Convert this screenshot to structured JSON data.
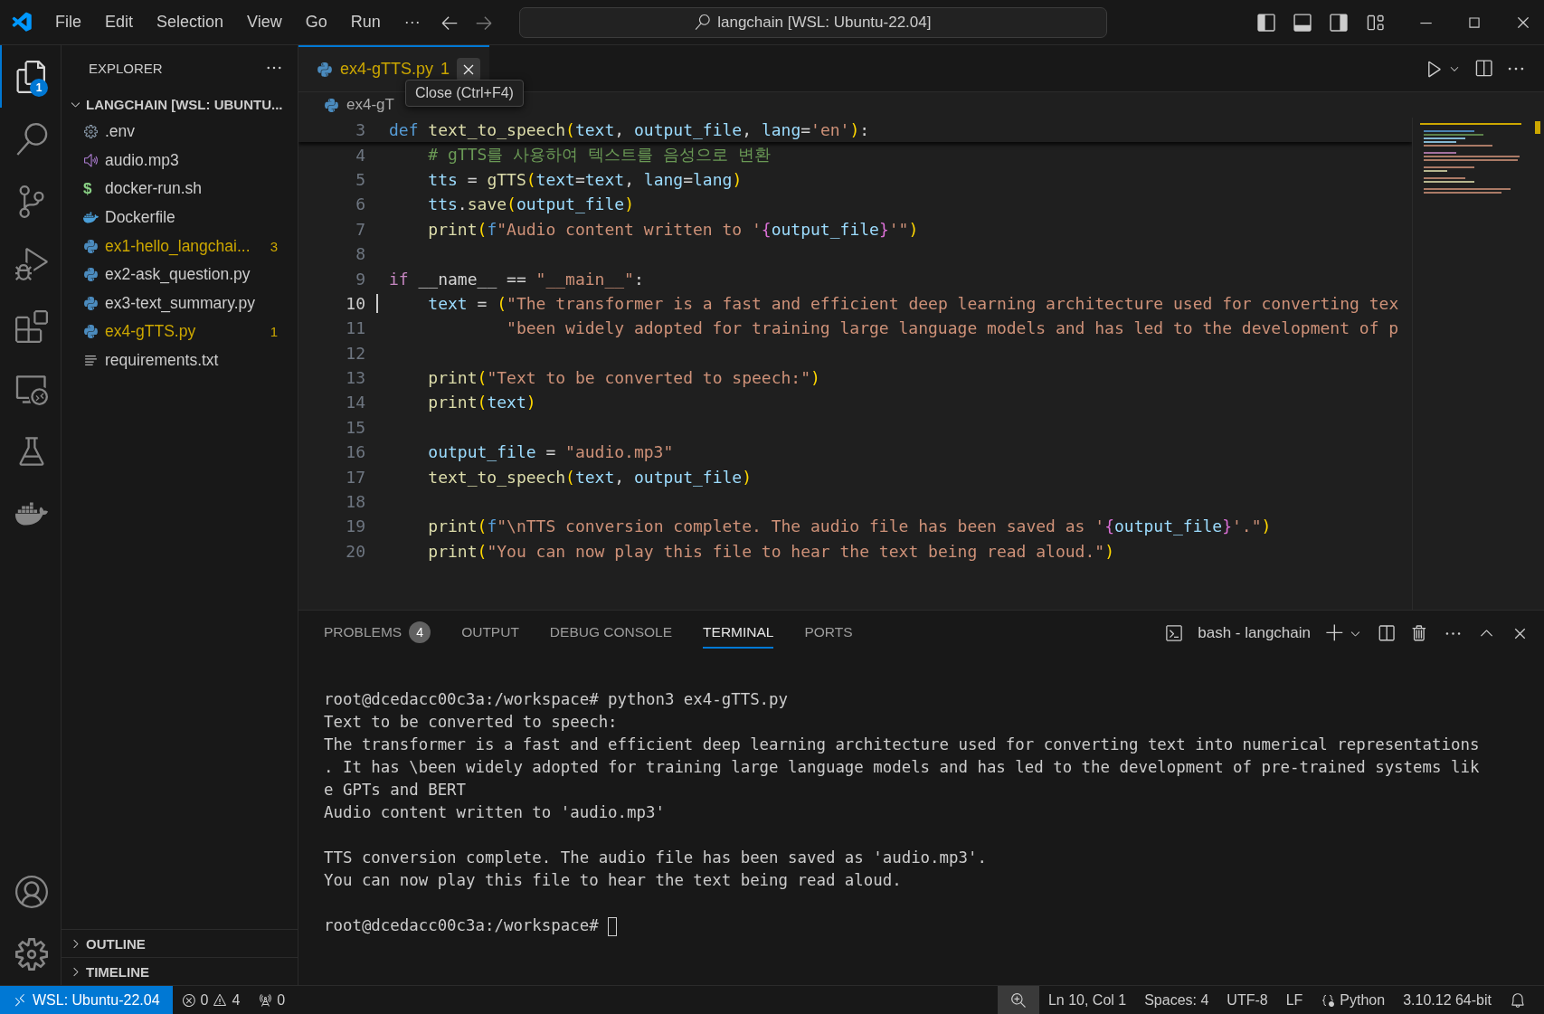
{
  "title_bar": {
    "menu": [
      "File",
      "Edit",
      "Selection",
      "View",
      "Go",
      "Run",
      "···"
    ],
    "search": "langchain [WSL: Ubuntu-22.04]"
  },
  "activity_bar": {
    "top": [
      {
        "kind": "files",
        "selected": true,
        "badge": "1"
      },
      {
        "kind": "search",
        "selected": false
      },
      {
        "kind": "source-control",
        "selected": false
      },
      {
        "kind": "run-debug",
        "selected": false
      },
      {
        "kind": "extensions",
        "selected": false
      },
      {
        "kind": "remote",
        "selected": false
      },
      {
        "kind": "testing",
        "selected": false
      },
      {
        "kind": "docker",
        "selected": false
      }
    ],
    "bottom": [
      {
        "kind": "account",
        "selected": false
      },
      {
        "kind": "settings",
        "selected": false
      }
    ]
  },
  "sidebar": {
    "title": "EXPLORER",
    "folder": {
      "label": "LANGCHAIN [WSL: UBUNTU...",
      "expanded": true
    },
    "files": [
      {
        "name": ".env",
        "kind": "config",
        "warning": false
      },
      {
        "name": "audio.mp3",
        "kind": "audio",
        "warning": false
      },
      {
        "name": "docker-run.sh",
        "kind": "shell",
        "glyph": "$",
        "warning": false
      },
      {
        "name": "Dockerfile",
        "kind": "docker",
        "warning": false
      },
      {
        "name": "ex1-hello_langchai...",
        "kind": "python",
        "warning": true,
        "badge": "3"
      },
      {
        "name": "ex2-ask_question.py",
        "kind": "python",
        "warning": false
      },
      {
        "name": "ex3-text_summary.py",
        "kind": "python",
        "warning": false
      },
      {
        "name": "ex4-gTTS.py",
        "kind": "python",
        "warning": true,
        "badge": "1"
      },
      {
        "name": "requirements.txt",
        "kind": "text",
        "warning": false
      }
    ],
    "sections": [
      {
        "label": "OUTLINE",
        "expanded": false
      },
      {
        "label": "TIMELINE",
        "expanded": false
      }
    ]
  },
  "editor": {
    "tabs": [
      {
        "label": "ex4-gTTS.py",
        "badge": "1",
        "selected": true,
        "warning": true
      }
    ],
    "tooltip": "Close (Ctrl+F4)",
    "breadcrumb": "ex4-gT",
    "sticky_line": {
      "num": "3",
      "tokens": [
        {
          "t": "def",
          "kind": "kw"
        },
        {
          "t": " text_to_speech",
          "kind": "fn"
        },
        {
          "t": "(",
          "kind": "br"
        },
        {
          "t": "text",
          "kind": "var"
        },
        {
          "t": ", ",
          "kind": "p"
        },
        {
          "t": "output_file",
          "kind": "var"
        },
        {
          "t": ", ",
          "kind": "p"
        },
        {
          "t": "lang",
          "kind": "var"
        },
        {
          "t": "=",
          "kind": "p"
        },
        {
          "t": "'en'",
          "kind": "str"
        },
        {
          "t": ")",
          "kind": "br"
        },
        {
          "t": ":",
          "kind": "p"
        }
      ]
    },
    "lines": [
      {
        "num": "4",
        "current": false,
        "tokens": [
          {
            "t": "    # gTTS를 사용하여 텍스트를 음성으로 변환",
            "kind": "com"
          }
        ]
      },
      {
        "num": "5",
        "current": false,
        "tokens": [
          {
            "t": "    tts",
            "kind": "var"
          },
          {
            "t": " = ",
            "kind": "p"
          },
          {
            "t": "gTTS",
            "kind": "fn"
          },
          {
            "t": "(",
            "kind": "br"
          },
          {
            "t": "text",
            "kind": "var"
          },
          {
            "t": "=",
            "kind": "p"
          },
          {
            "t": "text",
            "kind": "var"
          },
          {
            "t": ", ",
            "kind": "p"
          },
          {
            "t": "lang",
            "kind": "var"
          },
          {
            "t": "=",
            "kind": "p"
          },
          {
            "t": "lang",
            "kind": "var"
          },
          {
            "t": ")",
            "kind": "br"
          }
        ]
      },
      {
        "num": "6",
        "current": false,
        "tokens": [
          {
            "t": "    tts",
            "kind": "var"
          },
          {
            "t": ".",
            "kind": "p"
          },
          {
            "t": "save",
            "kind": "fn"
          },
          {
            "t": "(",
            "kind": "br"
          },
          {
            "t": "output_file",
            "kind": "var"
          },
          {
            "t": ")",
            "kind": "br"
          }
        ]
      },
      {
        "num": "7",
        "current": false,
        "tokens": [
          {
            "t": "    print",
            "kind": "fn"
          },
          {
            "t": "(",
            "kind": "br"
          },
          {
            "t": "f",
            "kind": "kw"
          },
          {
            "t": "\"Audio content written to '",
            "kind": "str"
          },
          {
            "t": "{",
            "kind": "brace"
          },
          {
            "t": "output_file",
            "kind": "var"
          },
          {
            "t": "}",
            "kind": "brace"
          },
          {
            "t": "'\"",
            "kind": "str"
          },
          {
            "t": ")",
            "kind": "br"
          }
        ]
      },
      {
        "num": "8",
        "current": false
      },
      {
        "num": "9",
        "current": false,
        "tokens": [
          {
            "t": "if",
            "kind": "ctl"
          },
          {
            "t": " __name__ == ",
            "kind": "p"
          },
          {
            "t": "\"__main__\"",
            "kind": "str"
          },
          {
            "t": ":",
            "kind": "p"
          }
        ]
      },
      {
        "num": "10",
        "current": true,
        "tokens": [
          {
            "t": "    text",
            "kind": "var"
          },
          {
            "t": " = ",
            "kind": "p"
          },
          {
            "t": "(",
            "kind": "br"
          },
          {
            "t": "\"The transformer is a fast and efficient deep learning architecture used for converting tex",
            "kind": "str"
          }
        ]
      },
      {
        "num": "11",
        "current": false,
        "tokens": [
          {
            "t": "            \"been widely adopted for training large language models and has led to the development of p",
            "kind": "str"
          }
        ]
      },
      {
        "num": "12",
        "current": false
      },
      {
        "num": "13",
        "current": false,
        "tokens": [
          {
            "t": "    print",
            "kind": "fn"
          },
          {
            "t": "(",
            "kind": "br"
          },
          {
            "t": "\"Text to be converted to speech:\"",
            "kind": "str"
          },
          {
            "t": ")",
            "kind": "br"
          }
        ]
      },
      {
        "num": "14",
        "current": false,
        "tokens": [
          {
            "t": "    print",
            "kind": "fn"
          },
          {
            "t": "(",
            "kind": "br"
          },
          {
            "t": "text",
            "kind": "var"
          },
          {
            "t": ")",
            "kind": "br"
          }
        ]
      },
      {
        "num": "15",
        "current": false
      },
      {
        "num": "16",
        "current": false,
        "tokens": [
          {
            "t": "    output_file",
            "kind": "var"
          },
          {
            "t": " = ",
            "kind": "p"
          },
          {
            "t": "\"audio.mp3\"",
            "kind": "str"
          }
        ]
      },
      {
        "num": "17",
        "current": false,
        "tokens": [
          {
            "t": "    text_to_speech",
            "kind": "fn"
          },
          {
            "t": "(",
            "kind": "br"
          },
          {
            "t": "text",
            "kind": "var"
          },
          {
            "t": ", ",
            "kind": "p"
          },
          {
            "t": "output_file",
            "kind": "var"
          },
          {
            "t": ")",
            "kind": "br"
          }
        ]
      },
      {
        "num": "18",
        "current": false
      },
      {
        "num": "19",
        "current": false,
        "tokens": [
          {
            "t": "    print",
            "kind": "fn"
          },
          {
            "t": "(",
            "kind": "br"
          },
          {
            "t": "f",
            "kind": "kw"
          },
          {
            "t": "\"\\nTTS conversion complete. The audio file has been saved as '",
            "kind": "str"
          },
          {
            "t": "{",
            "kind": "brace"
          },
          {
            "t": "output_file",
            "kind": "var"
          },
          {
            "t": "}",
            "kind": "brace"
          },
          {
            "t": "'.\"",
            "kind": "str"
          },
          {
            "t": ")",
            "kind": "br"
          }
        ]
      },
      {
        "num": "20",
        "current": false,
        "tokens": [
          {
            "t": "    print",
            "kind": "fn"
          },
          {
            "t": "(",
            "kind": "br"
          },
          {
            "t": "\"You can now play this file to hear the text being read aloud.\"",
            "kind": "str"
          },
          {
            "t": ")",
            "kind": "br"
          }
        ]
      }
    ]
  },
  "panel": {
    "tabs": [
      {
        "label": "PROBLEMS",
        "badge": "4",
        "selected": false
      },
      {
        "label": "OUTPUT",
        "selected": false
      },
      {
        "label": "DEBUG CONSOLE",
        "selected": false
      },
      {
        "label": "TERMINAL",
        "selected": true
      },
      {
        "label": "PORTS",
        "selected": false
      }
    ],
    "terminal_name": "bash - langchain",
    "terminal_blocks": [
      [
        "root@dcedacc00c3a:/workspace# python3 ex4-gTTS.py",
        "Text to be converted to speech:",
        "The transformer is a fast and efficient deep learning architecture used for converting text into numerical representations",
        ". It has \\been widely adopted for training large language models and has led to the development of pre-trained systems lik",
        "e GPTs and BERT",
        "Audio content written to 'audio.mp3'"
      ],
      [
        "TTS conversion complete. The audio file has been saved as 'audio.mp3'.",
        "You can now play this file to hear the text being read aloud."
      ]
    ],
    "prompt": "root@dcedacc00c3a:/workspace#"
  },
  "status_bar": {
    "remote": "WSL: Ubuntu-22.04",
    "errors": "0",
    "warnings": "4",
    "ports": "0",
    "right": [
      {
        "kind": "zoom"
      },
      {
        "kind": "text",
        "label": "Ln 10, Col 1"
      },
      {
        "kind": "text",
        "label": "Spaces: 4"
      },
      {
        "kind": "text",
        "label": "UTF-8"
      },
      {
        "kind": "text",
        "label": "LF"
      },
      {
        "kind": "language",
        "label": "Python"
      },
      {
        "kind": "text",
        "label": "3.10.12 64-bit"
      },
      {
        "kind": "bell"
      }
    ]
  }
}
